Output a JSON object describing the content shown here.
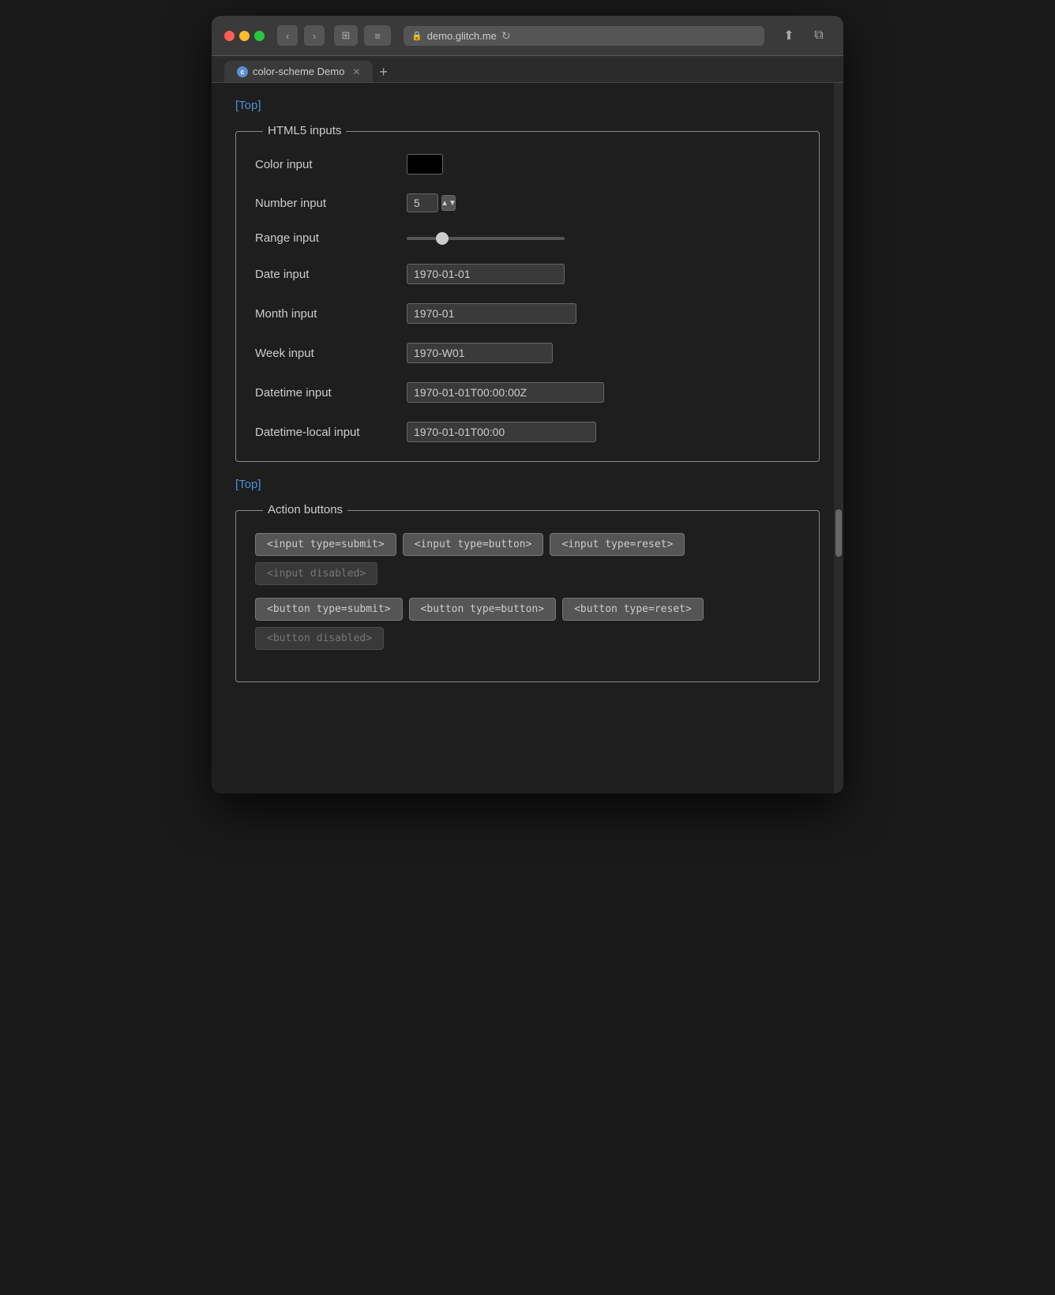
{
  "browser": {
    "url": "demo.glitch.me",
    "tab_title": "color-scheme Demo",
    "tab_favicon_letter": "c"
  },
  "nav": {
    "back_label": "‹",
    "forward_label": "›",
    "sidebar_label": "□",
    "menu_label": "≡",
    "reload_label": "↻",
    "share_label": "↑",
    "new_window_label": "⧉",
    "new_tab_label": "+"
  },
  "page": {
    "top_link": "[Top]",
    "html5_section": {
      "legend": "HTML5 inputs",
      "fields": [
        {
          "label": "Color input",
          "type": "color",
          "value": "#000000"
        },
        {
          "label": "Number input",
          "type": "number",
          "value": "5"
        },
        {
          "label": "Range input",
          "type": "range",
          "value": "20"
        },
        {
          "label": "Date input",
          "type": "date",
          "value": "1970-01-01"
        },
        {
          "label": "Month input",
          "type": "month",
          "value": "1970-01"
        },
        {
          "label": "Week input",
          "type": "week",
          "value": "1970-W01"
        },
        {
          "label": "Datetime input",
          "type": "datetime",
          "value": "1970-01-01T00:00:00Z"
        },
        {
          "label": "Datetime-local input",
          "type": "datetime-local",
          "value": "1970-01-01T00:00"
        }
      ]
    },
    "bottom_top_link": "[Top]",
    "action_buttons_section": {
      "legend": "Action buttons",
      "input_buttons": [
        {
          "label": "<input type=submit>",
          "disabled": false
        },
        {
          "label": "<input type=button>",
          "disabled": false
        },
        {
          "label": "<input type=reset>",
          "disabled": false
        },
        {
          "label": "<input disabled>",
          "disabled": true
        }
      ],
      "button_buttons": [
        {
          "label": "<button type=submit>",
          "disabled": false
        },
        {
          "label": "<button type=button>",
          "disabled": false
        },
        {
          "label": "<button type=reset>",
          "disabled": false
        },
        {
          "label": "<button disabled>",
          "disabled": true
        }
      ]
    }
  }
}
